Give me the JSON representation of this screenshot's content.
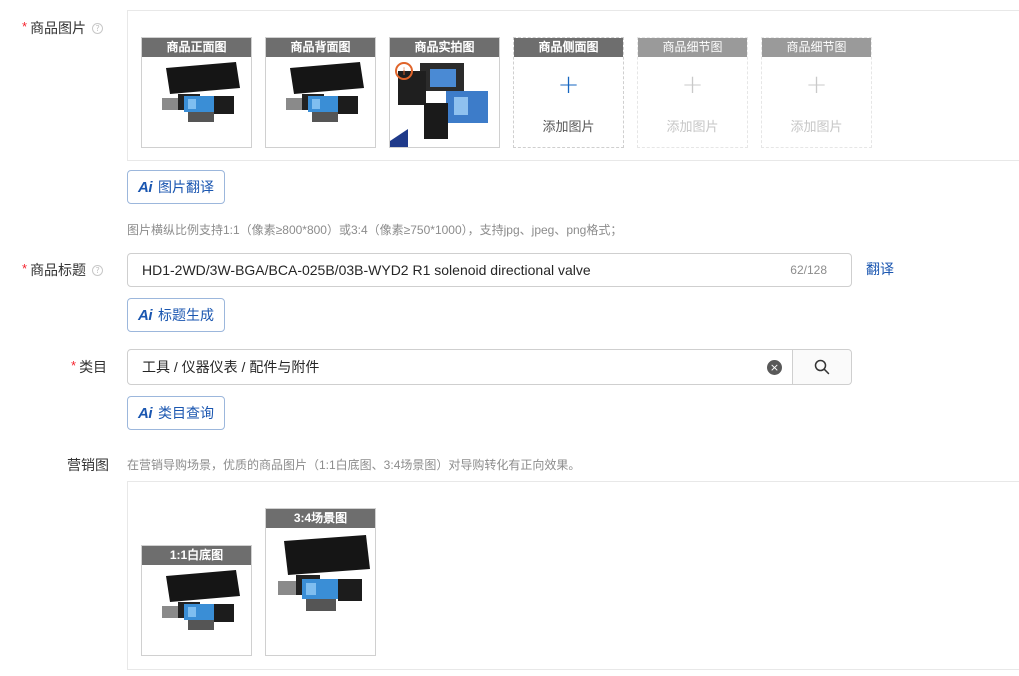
{
  "images_section": {
    "label": "商品图片",
    "slots": [
      {
        "caption": "商品正面图",
        "state": "filled"
      },
      {
        "caption": "商品背面图",
        "state": "filled"
      },
      {
        "caption": "商品实拍图",
        "state": "filled"
      },
      {
        "caption": "商品侧面图",
        "state": "add",
        "add_label": "添加图片"
      },
      {
        "caption": "商品细节图",
        "state": "add-disabled",
        "add_label": "添加图片"
      },
      {
        "caption": "商品细节图",
        "state": "add-disabled",
        "add_label": "添加图片"
      }
    ],
    "ai_button": {
      "mark": "Ai",
      "label": "图片翻译"
    },
    "hint": "图片横纵比例支持1:1（像素≥800*800）或3:4（像素≥750*1000），支持jpg、jpeg、png格式；"
  },
  "title_section": {
    "label": "商品标题",
    "value": "HD1-2WD/3W-BGA/BCA-025B/03B-WYD2 R1 solenoid directional valve",
    "counter": "62/128",
    "translate_link": "翻译",
    "ai_button": {
      "mark": "Ai",
      "label": "标题生成"
    }
  },
  "category_section": {
    "label": "类目",
    "value": "工具 / 仪器仪表 / 配件与附件",
    "clear_icon": "clear-circle-icon",
    "search_icon": "search-icon",
    "ai_button": {
      "mark": "Ai",
      "label": "类目查询"
    }
  },
  "marketing_section": {
    "label": "营销图",
    "hint": "在营销导购场景，优质的商品图片（1:1白底图、3:4场景图）对导购转化有正向效果。",
    "slots": [
      {
        "caption": "1:1白底图"
      },
      {
        "caption": "3:4场景图"
      }
    ]
  },
  "colors": {
    "accent": "#1a56b0",
    "required": "#f5222d",
    "caption_bg": "#6e6e6e",
    "border": "#cfcfcf"
  }
}
